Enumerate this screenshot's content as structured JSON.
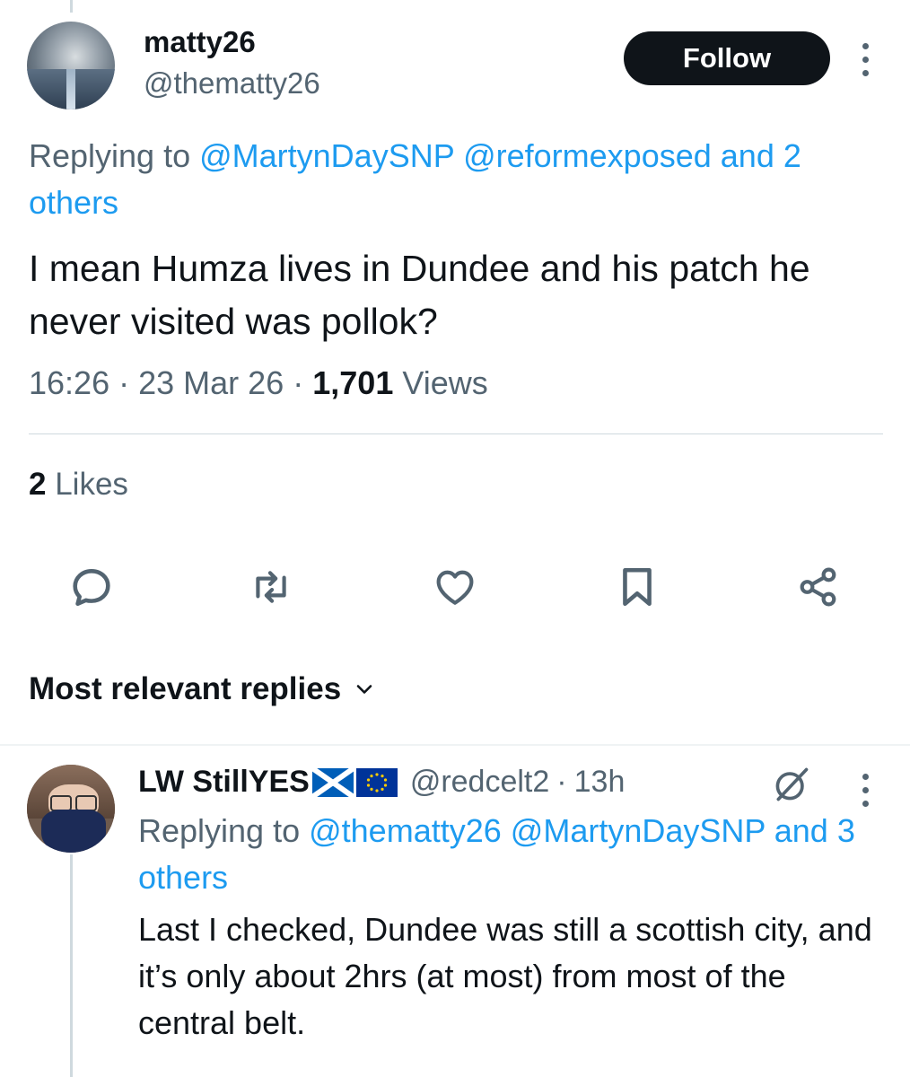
{
  "tweet": {
    "author": {
      "display_name": "matty26",
      "handle": "@thematty26"
    },
    "follow_label": "Follow",
    "replying_prefix": "Replying to ",
    "replying_mentions": [
      "@MartynDaySNP",
      "@reformexposed"
    ],
    "replying_others": "and 2 others",
    "text": "I mean Humza lives in Dundee and his patch he never visited was pollok?",
    "time": "16:26",
    "date": "23 Mar 26",
    "separator": "·",
    "views_count": "1,701",
    "views_label": "Views",
    "likes_count": "2",
    "likes_label": "Likes"
  },
  "actions": {
    "icons": [
      "reply-icon",
      "retweet-icon",
      "like-icon",
      "bookmark-icon",
      "share-icon"
    ]
  },
  "sort": {
    "label": "Most relevant replies"
  },
  "reply": {
    "display_name": "LW StillYES",
    "flags": [
      "scotland-flag-icon",
      "eu-flag-icon"
    ],
    "handle": "@redcelt2",
    "time": "13h",
    "replying_prefix": "Replying to ",
    "replying_mentions": [
      "@thematty26",
      "@MartynDaySNP"
    ],
    "replying_others": "and 3 others",
    "text": "Last I checked, Dundee was still a scottish city, and it’s only about 2hrs (at most) from most of the central belt."
  },
  "colors": {
    "text_primary": "#0f1419",
    "text_secondary": "#536471",
    "link": "#1d9bf0",
    "border": "#cfd9de"
  }
}
